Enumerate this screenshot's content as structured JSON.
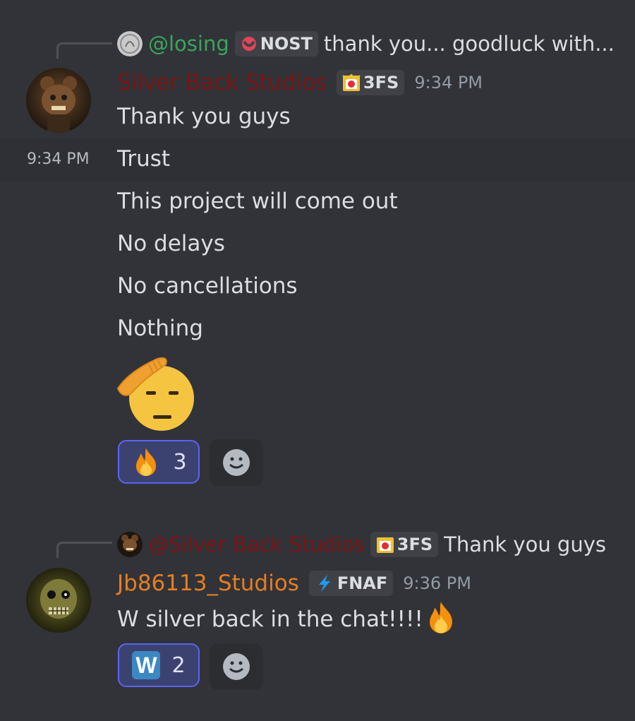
{
  "message1": {
    "reply": {
      "name": "@losing",
      "tag": "NOST",
      "text": "thank you... goodluck with..."
    },
    "author": {
      "name": "Silver Back Studios",
      "color": "#7a1414",
      "tag": "3FS",
      "time": "9:34 PM"
    },
    "lines": [
      "Thank you guys",
      "Trust",
      "This project will come out",
      "No delays",
      "No cancellations",
      "Nothing"
    ],
    "hover_time": "9:34 PM",
    "emoji_name": "saluting-face",
    "reaction": {
      "emoji": "fire",
      "count": "3"
    }
  },
  "message2": {
    "reply": {
      "name": "@Silver Back Studios",
      "tag": "3FS",
      "text": "Thank you guys"
    },
    "author": {
      "name": "Jb86113_Studios",
      "color": "#e67e22",
      "tag": "FNAF",
      "time": "9:36 PM"
    },
    "text": "W silver back in the chat!!!!",
    "text_emoji": "fire",
    "reaction": {
      "emoji": "regional-indicator-w",
      "label": "W",
      "count": "2"
    }
  },
  "colors": {
    "background": "#313338",
    "accent": "#5865f2",
    "muted": "#949ba4"
  }
}
